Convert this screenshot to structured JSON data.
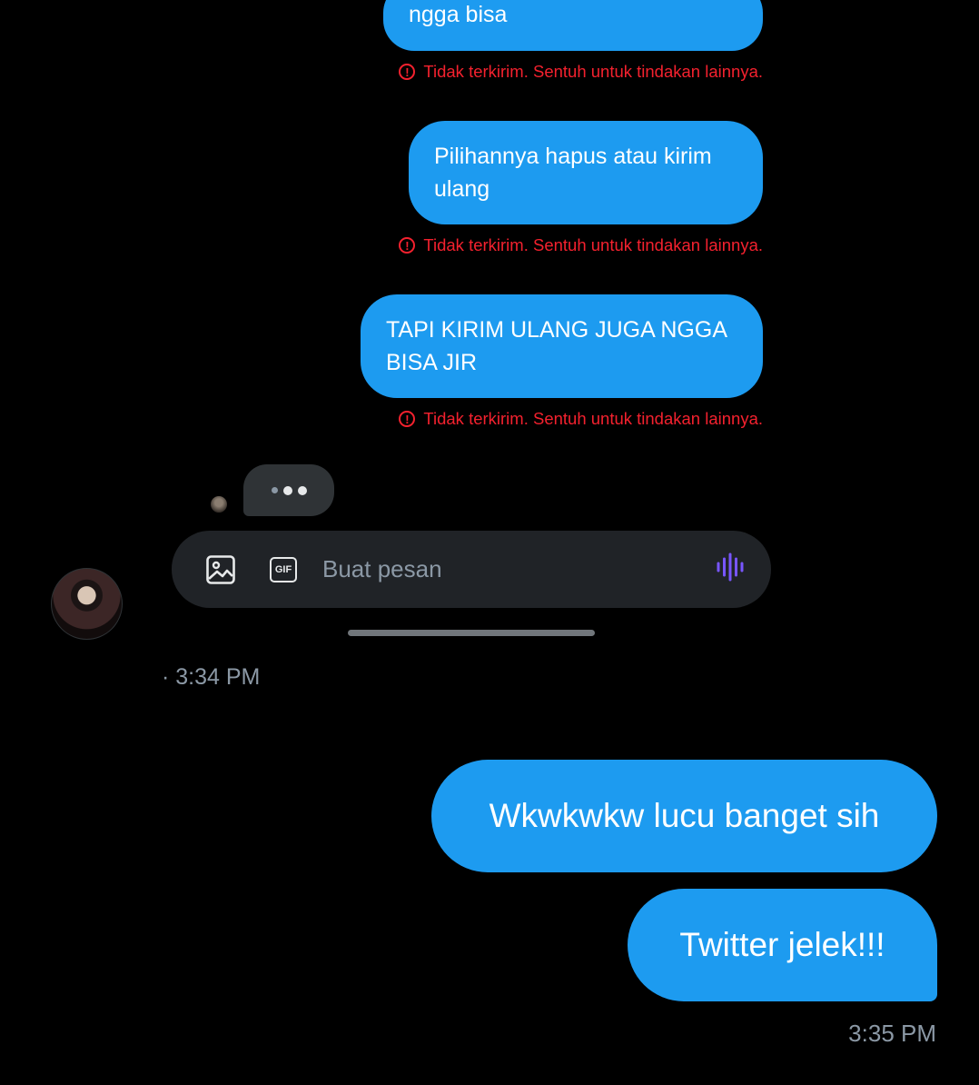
{
  "embedded_screenshot": {
    "messages": [
      {
        "text": "ngga bisa",
        "status": "Tidak terkirim. Sentuh untuk tindakan lainnya."
      },
      {
        "text": "Pilihannya hapus atau kirim ulang",
        "status": "Tidak terkirim. Sentuh untuk tindakan lainnya."
      },
      {
        "text": "TAPI KIRIM ULANG JUGA NGGA BISA JIR",
        "status": "Tidak terkirim. Sentuh untuk tindakan lainnya."
      }
    ],
    "error_icon": "!",
    "composer": {
      "placeholder": "Buat pesan",
      "gif_label": "GIF"
    }
  },
  "incoming": {
    "timestamp": "· 3:34 PM"
  },
  "outgoing": {
    "messages": [
      "Wkwkwkw lucu banget sih",
      "Twitter jelek!!!"
    ],
    "timestamp": "3:35 PM"
  },
  "colors": {
    "background": "#000000",
    "bubble_blue": "#1d9bf0",
    "error_red": "#f4212e",
    "muted_text": "#8b98a5",
    "voice_purple": "#7856ff"
  }
}
